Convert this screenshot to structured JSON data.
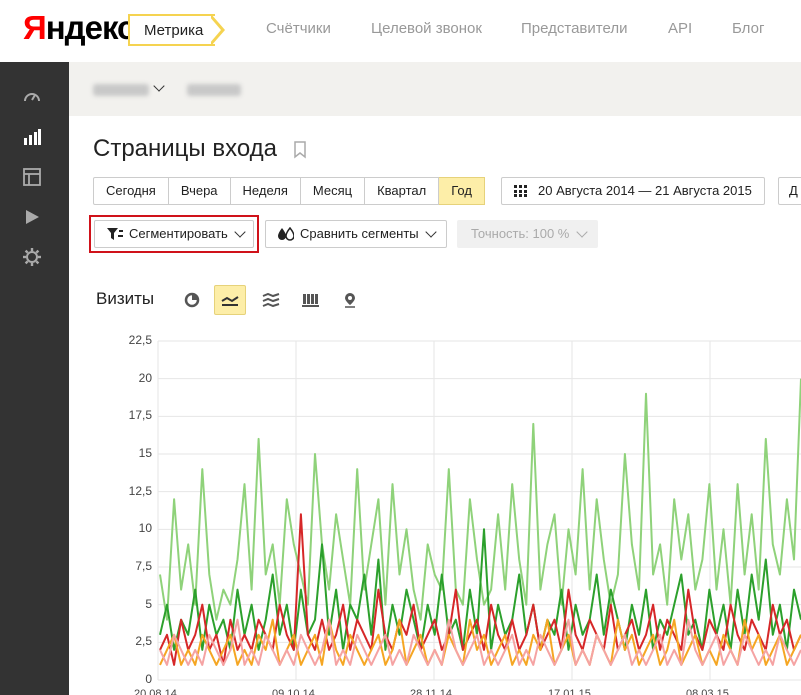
{
  "header": {
    "logo_first": "Я",
    "logo_rest": "ндекс",
    "product": "Метрика",
    "nav": [
      "Счётчики",
      "Целевой звонок",
      "Представители",
      "API",
      "Блог"
    ]
  },
  "sidebar": {
    "icons": [
      "dashboard-icon",
      "reports-icon",
      "layout-icon",
      "play-icon",
      "settings-icon"
    ]
  },
  "page": {
    "title": "Страницы входа"
  },
  "periods": [
    "Сегодня",
    "Вчера",
    "Неделя",
    "Месяц",
    "Квартал",
    "Год"
  ],
  "active_period": "Год",
  "date_range": "20 Августа 2014 — 21 Августа 2015",
  "more_label": "Д",
  "toolbar": {
    "segment": "Сегментировать",
    "compare": "Сравнить сегменты",
    "accuracy": "Точность: 100 %"
  },
  "chart_section": {
    "label": "Визиты"
  },
  "colors": {
    "accent_yellow": "#fdeea8",
    "highlight_red": "#d0121a",
    "series_light_green": "#8fd27a",
    "series_green": "#2ca02c",
    "series_red": "#d62728",
    "series_orange": "#f5a623",
    "series_pink": "#f5a3a3"
  },
  "chart_data": {
    "type": "line",
    "ylim": [
      0,
      22.5
    ],
    "yticks": [
      "22,5",
      "20",
      "17,5",
      "15",
      "12,5",
      "10",
      "7,5",
      "5",
      "2,5",
      "0"
    ],
    "xticks": [
      "20.08.14",
      "09.10.14",
      "28.11.14",
      "17.01.15",
      "08.03.15"
    ],
    "series": [
      {
        "color": "#8fd27a",
        "values": [
          7,
          4,
          12,
          6,
          9,
          5,
          14,
          7,
          4,
          6,
          5,
          8,
          13,
          6,
          16,
          7,
          9,
          5,
          12,
          9,
          7,
          5,
          15,
          9,
          6,
          11,
          8,
          5,
          14,
          6,
          9,
          12,
          5,
          13,
          7,
          10,
          6,
          4,
          9,
          7,
          6,
          14,
          6,
          5,
          12,
          8,
          5,
          6,
          11,
          6,
          13,
          8,
          5,
          17,
          6,
          9,
          11,
          5,
          10,
          7,
          14,
          6,
          12,
          8,
          5,
          7,
          15,
          9,
          6,
          19,
          7,
          9,
          5,
          12,
          8,
          11,
          6,
          8,
          13,
          6,
          10,
          5,
          13,
          7,
          11,
          6,
          16,
          9,
          7,
          12,
          8,
          20
        ]
      },
      {
        "color": "#2ca02c",
        "values": [
          3,
          5,
          2,
          4,
          3,
          6,
          2,
          5,
          3,
          4,
          2,
          6,
          3,
          5,
          2,
          4,
          7,
          3,
          5,
          2,
          6,
          3,
          4,
          9,
          3,
          6,
          2,
          5,
          4,
          7,
          3,
          8,
          2,
          5,
          3,
          6,
          4,
          2,
          5,
          3,
          7,
          3,
          4,
          2,
          6,
          3,
          10,
          2,
          5,
          3,
          4,
          7,
          3,
          5,
          2,
          4,
          3,
          6,
          2,
          5,
          3,
          4,
          7,
          3,
          6,
          4,
          2,
          5,
          3,
          6,
          2,
          4,
          3,
          5,
          7,
          3,
          4,
          2,
          6,
          3,
          5,
          2,
          6,
          3,
          7,
          4,
          8,
          3,
          5,
          2,
          6,
          4
        ]
      },
      {
        "color": "#d62728",
        "values": [
          2,
          3,
          1,
          4,
          2,
          3,
          5,
          2,
          3,
          1,
          4,
          2,
          3,
          2,
          4,
          3,
          2,
          5,
          3,
          2,
          11,
          3,
          2,
          4,
          2,
          3,
          5,
          2,
          4,
          3,
          2,
          6,
          3,
          2,
          4,
          3,
          5,
          2,
          3,
          4,
          2,
          3,
          6,
          2,
          3,
          4,
          2,
          5,
          3,
          2,
          4,
          2,
          3,
          5,
          2,
          3,
          4,
          2,
          6,
          3,
          2,
          4,
          3,
          2,
          5,
          2,
          3,
          4,
          2,
          3,
          5,
          2,
          4,
          3,
          2,
          6,
          3,
          2,
          4,
          3,
          2,
          5,
          3,
          2,
          4,
          3,
          2,
          5,
          3,
          4,
          2,
          3
        ]
      },
      {
        "color": "#f5a623",
        "values": [
          1,
          2,
          3,
          1,
          2,
          1,
          3,
          2,
          1,
          2,
          3,
          1,
          2,
          1,
          3,
          2,
          4,
          1,
          2,
          3,
          1,
          2,
          3,
          1,
          4,
          2,
          1,
          3,
          2,
          1,
          2,
          3,
          1,
          2,
          4,
          1,
          2,
          3,
          1,
          2,
          1,
          3,
          2,
          1,
          4,
          2,
          3,
          1,
          2,
          3,
          1,
          2,
          1,
          3,
          2,
          4,
          1,
          2,
          3,
          1,
          2,
          1,
          3,
          2,
          1,
          4,
          2,
          3,
          1,
          2,
          3,
          1,
          2,
          4,
          1,
          2,
          3,
          1,
          2,
          1,
          3,
          2,
          1,
          4,
          2,
          3,
          1,
          2,
          3,
          1,
          2,
          3
        ]
      },
      {
        "color": "#f5a3a3",
        "values": [
          2,
          1,
          3,
          2,
          1,
          2,
          1,
          3,
          2,
          1,
          2,
          4,
          1,
          2,
          1,
          3,
          2,
          1,
          2,
          1,
          3,
          2,
          1,
          2,
          4,
          1,
          2,
          1,
          3,
          2,
          1,
          2,
          3,
          1,
          2,
          1,
          3,
          2,
          1,
          2,
          1,
          4,
          2,
          1,
          2,
          3,
          1,
          2,
          1,
          2,
          3,
          1,
          2,
          1,
          3,
          2,
          1,
          2,
          4,
          1,
          2,
          1,
          3,
          2,
          1,
          2,
          3,
          1,
          2,
          1,
          2,
          3,
          1,
          2,
          1,
          4,
          2,
          1,
          2,
          3,
          1,
          2,
          1,
          3,
          2,
          1,
          2,
          1,
          3,
          2,
          1,
          2
        ]
      }
    ]
  }
}
